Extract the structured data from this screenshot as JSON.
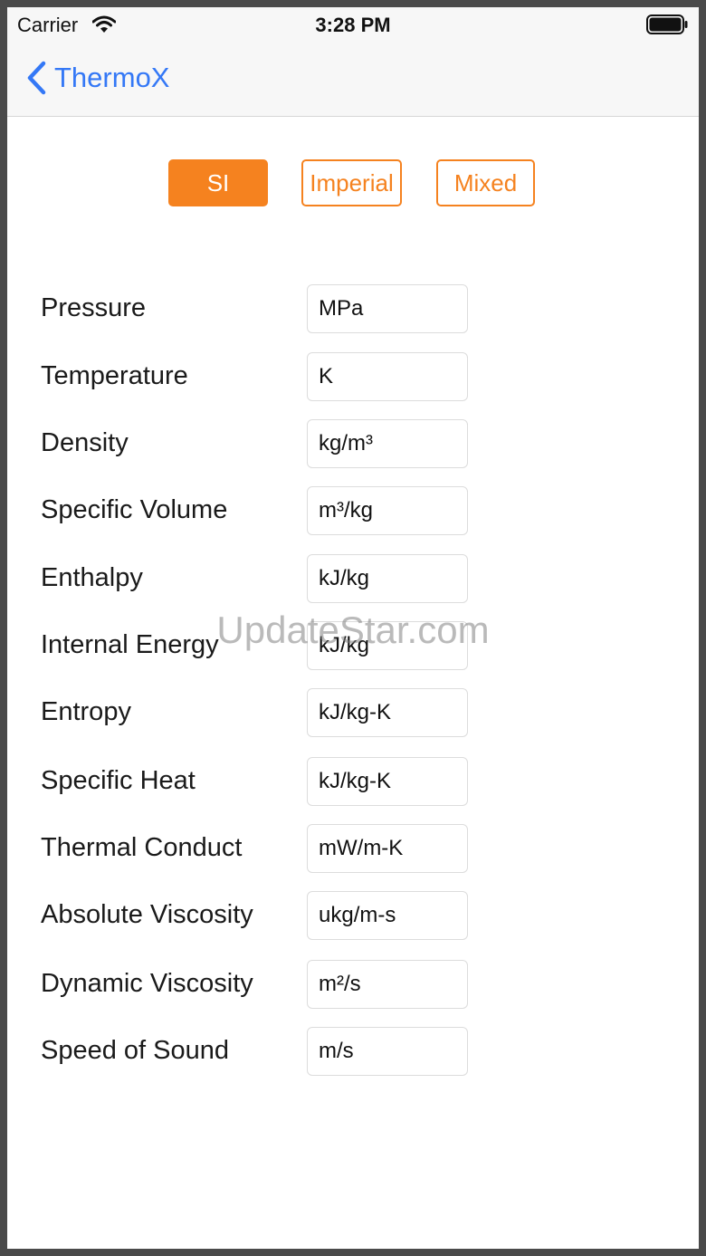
{
  "status_bar": {
    "carrier": "Carrier",
    "time": "3:28 PM",
    "icons": [
      "wifi-icon",
      "battery-icon"
    ]
  },
  "nav": {
    "back_label": "ThermoX",
    "back_icon": "chevron-left-icon",
    "accent_color": "#3478f6"
  },
  "unit_systems": {
    "accent_color": "#f5821f",
    "selected": "SI",
    "options": [
      {
        "label": "SI"
      },
      {
        "label": "Imperial"
      },
      {
        "label": "Mixed"
      }
    ]
  },
  "properties": [
    {
      "name": "Pressure",
      "unit": "MPa"
    },
    {
      "name": "Temperature",
      "unit": "K"
    },
    {
      "name": "Density",
      "unit": "kg/m³"
    },
    {
      "name": "Specific Volume",
      "unit": "m³/kg"
    },
    {
      "name": "Enthalpy",
      "unit": "kJ/kg"
    },
    {
      "name": "Internal Energy",
      "unit": "kJ/kg"
    },
    {
      "name": "Entropy",
      "unit": "kJ/kg-K"
    },
    {
      "name": "Specific Heat",
      "unit": "kJ/kg-K"
    },
    {
      "name": "Thermal Conduct",
      "unit": "mW/m-K"
    },
    {
      "name": "Absolute Viscosity",
      "unit": "ukg/m-s"
    },
    {
      "name": "Dynamic Viscosity",
      "unit": "m²/s"
    },
    {
      "name": "Speed of Sound",
      "unit": "m/s"
    }
  ],
  "watermark": "UpdateStar.com"
}
